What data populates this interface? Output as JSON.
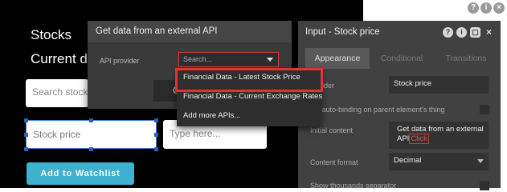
{
  "canvas": {
    "title": "Stocks",
    "subtitle": "Current d",
    "search_placeholder": "Search stock",
    "stock_price_placeholder": "Stock price",
    "type_here_placeholder": "Type here...",
    "watchlist_button": "Add to Watchlist"
  },
  "api_popup": {
    "title": "Get data from an external API",
    "provider_label": "API provider",
    "provider_select": "Search...",
    "button_fragment": "C",
    "dropdown_items": [
      "Financial Data - Latest Stock Price",
      "Financial Data - Current Exchange Rates",
      "Add more APIs..."
    ]
  },
  "property_panel": {
    "title": "Input - Stock price",
    "tabs": [
      "Appearance",
      "Conditional",
      "Transitions"
    ],
    "placeholder_label": "eholder",
    "placeholder_value": "Stock price",
    "autobinding_label": "ble auto-binding on parent element's thing",
    "initial_content_label": "Initial content",
    "initial_content_line1": "Get data from an external",
    "initial_content_line2_prefix": "API",
    "initial_content_click": "Click",
    "content_format_label": "Content format",
    "content_format_value": "Decimal",
    "thousands_label": "Show thousands separator"
  },
  "colors": {
    "accent_button": "#3db1cd",
    "highlight_border": "#e0332d",
    "selection_blue": "#4f7fd8"
  },
  "icons": [
    "help-icon",
    "info-icon",
    "comment-icon",
    "close-icon"
  ]
}
